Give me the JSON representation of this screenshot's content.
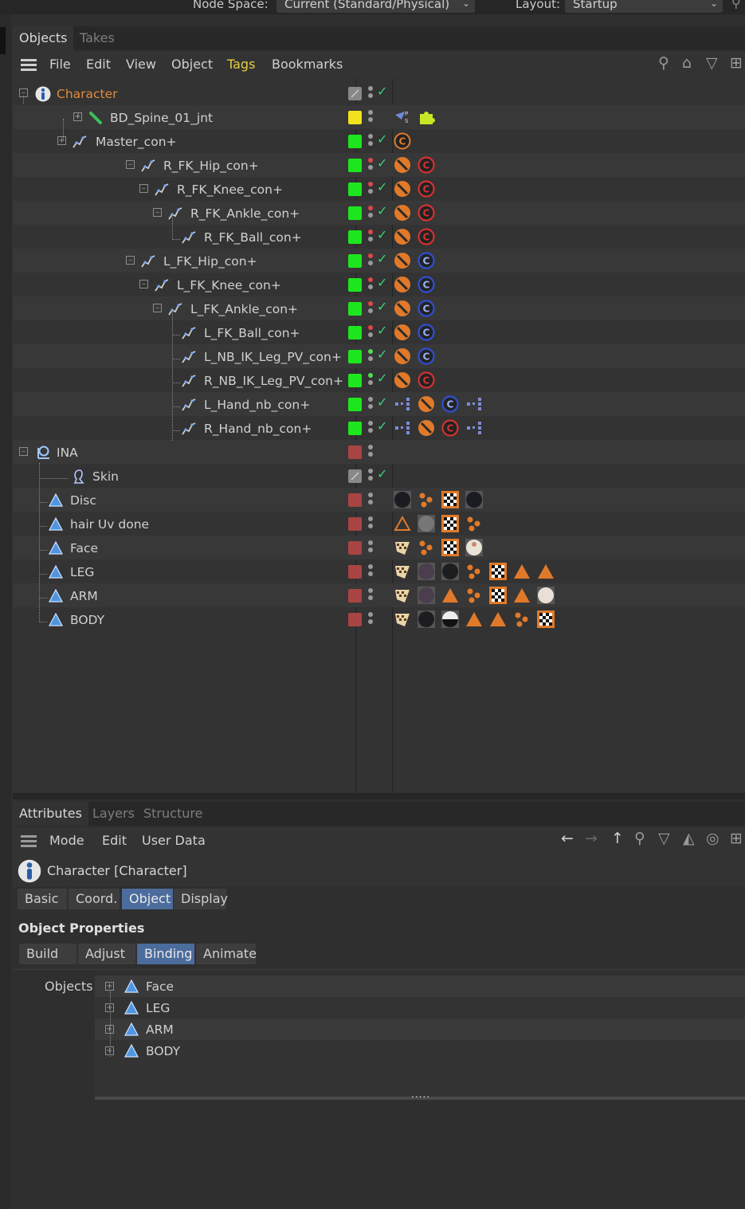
{
  "topbar": {
    "node_space_label": "Node Space:",
    "node_space_value": "Current (Standard/Physical)",
    "layout_label": "Layout:",
    "layout_value": "Startup"
  },
  "objects_panel": {
    "tabs": [
      "Objects",
      "Takes"
    ],
    "menu": [
      "File",
      "Edit",
      "View",
      "Object",
      "Tags",
      "Bookmarks"
    ],
    "active_menu_color": "#e6d040"
  },
  "tree": [
    {
      "name": "Character",
      "color": "#1aff1a",
      "layer": "gray"
    },
    {
      "name": "BD_Spine_01_jnt"
    },
    {
      "name": "Master_con+"
    },
    {
      "name": "R_FK_Hip_con+"
    },
    {
      "name": "R_FK_Knee_con+"
    },
    {
      "name": "R_FK_Ankle_con+"
    },
    {
      "name": "R_FK_Ball_con+"
    },
    {
      "name": "L_FK_Hip_con+"
    },
    {
      "name": "L_FK_Knee_con+"
    },
    {
      "name": "L_FK_Ankle_con+"
    },
    {
      "name": "L_FK_Ball_con+"
    },
    {
      "name": "L_NB_IK_Leg_PV_con+"
    },
    {
      "name": "R_NB_IK_Leg_PV_con+"
    },
    {
      "name": "L_Hand_nb_con+"
    },
    {
      "name": "R_Hand_nb_con+"
    },
    {
      "name": "INA"
    },
    {
      "name": "Skin"
    },
    {
      "name": "Disc"
    },
    {
      "name": "hair Uv done"
    },
    {
      "name": "Face"
    },
    {
      "name": "LEG"
    },
    {
      "name": "ARM"
    },
    {
      "name": "BODY"
    }
  ],
  "colors": {
    "character_orange": "#e08a3c",
    "green": "#1ee61e",
    "yellow": "#f2e21e",
    "red": "#a84444",
    "selected_blue": "#4b6c9c"
  },
  "attributes_panel": {
    "tabs": [
      "Attributes",
      "Layers",
      "Structure"
    ],
    "menu": [
      "Mode",
      "Edit",
      "User Data"
    ],
    "object_title": "Character [Character]",
    "tabs_row1": [
      "Basic",
      "Coord.",
      "Object",
      "Display"
    ],
    "tabs_row1_selected": "Object",
    "section_title": "Object Properties",
    "tabs_row2": [
      "Build",
      "Adjust",
      "Binding",
      "Animate"
    ],
    "tabs_row2_selected": "Binding",
    "objects_label": "Objects",
    "objects_list": [
      "Face",
      "LEG",
      "ARM",
      "BODY"
    ],
    "resize_handle": "....."
  }
}
